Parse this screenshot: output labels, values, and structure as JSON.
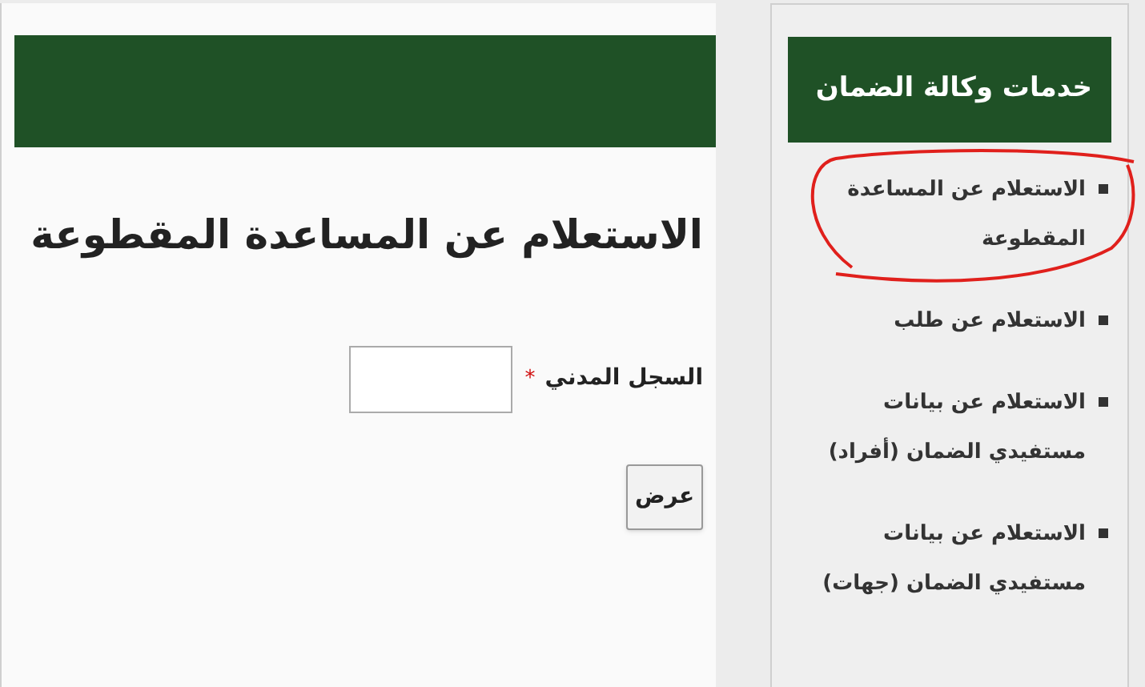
{
  "main": {
    "title": "الاستعلام عن المساعدة المقطوعة",
    "field": {
      "label": "السجل المدني",
      "required_mark": "*"
    },
    "button": "عرض"
  },
  "sidebar": {
    "title": "خدمات وكالة الضمان",
    "items": [
      {
        "label": "الاستعلام عن المساعدة المقطوعة",
        "highlighted": true
      },
      {
        "label": "الاستعلام عن طلب",
        "highlighted": false
      },
      {
        "label": "الاستعلام عن بيانات مستفيدي الضمان (أفراد)",
        "highlighted": false
      },
      {
        "label": "الاستعلام عن بيانات مستفيدي الضمان (جهات)",
        "highlighted": false
      }
    ]
  }
}
